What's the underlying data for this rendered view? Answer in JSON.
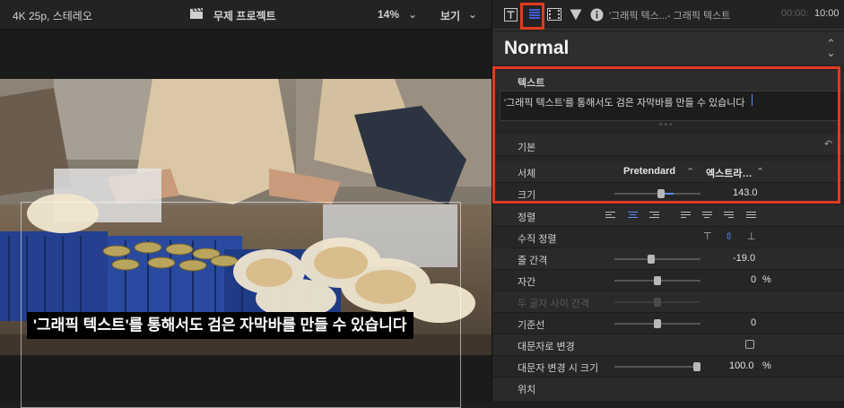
{
  "viewer": {
    "format": "4K 25p, 스테레오",
    "project": "무제 프로젝트",
    "zoom": "14%",
    "view_menu": "보기",
    "caption": "'그래픽 텍스트'를 통해서도 검은 자막바를 만들 수 있습니다"
  },
  "inspector": {
    "title": "'그래픽 텍스...- 그래픽 텍스트",
    "timecode_dim": "00:00:",
    "timecode": "10:00",
    "style": "Normal",
    "text_section": "텍스트",
    "text_value": "'그래픽 텍스트'를 통해서도 검은 자막바를 만들 수 있습니다",
    "basic_section": "기본",
    "font_label": "서체",
    "font_family": "Pretendard",
    "font_weight": "엑스트라…",
    "size_label": "크기",
    "size_value": "143.0",
    "size_level": 0.54,
    "alignment_label": "정렬",
    "vertical_alignment_label": "수직 정렬",
    "line_spacing_label": "줄 간격",
    "line_spacing_value": "-19.0",
    "line_spacing_level": 0.42,
    "tracking_label": "자간",
    "tracking_value": "0",
    "tracking_unit": "%",
    "tracking_level": 0.5,
    "kerning_label": "두 글자 사이 간격",
    "kerning_level": 0.5,
    "baseline_label": "기준선",
    "baseline_value": "0",
    "baseline_level": 0.5,
    "all_caps_label": "대문자로 변경",
    "all_caps_size_label": "대문자 변경 시 크기",
    "all_caps_size_value": "100.0",
    "all_caps_size_unit": "%",
    "all_caps_size_level": 1.0,
    "position_label": "위치"
  },
  "colors": {
    "highlight": "#e23a21",
    "accent": "#5b8cff",
    "panel": "#262626"
  },
  "icons": [
    "clapperboard-icon",
    "chevron-down-icon",
    "text-inspector-icon",
    "text-style-inspector-icon",
    "video-inspector-icon",
    "filter-inspector-icon",
    "info-icon",
    "chevron-updown-icon",
    "reset-icon"
  ]
}
